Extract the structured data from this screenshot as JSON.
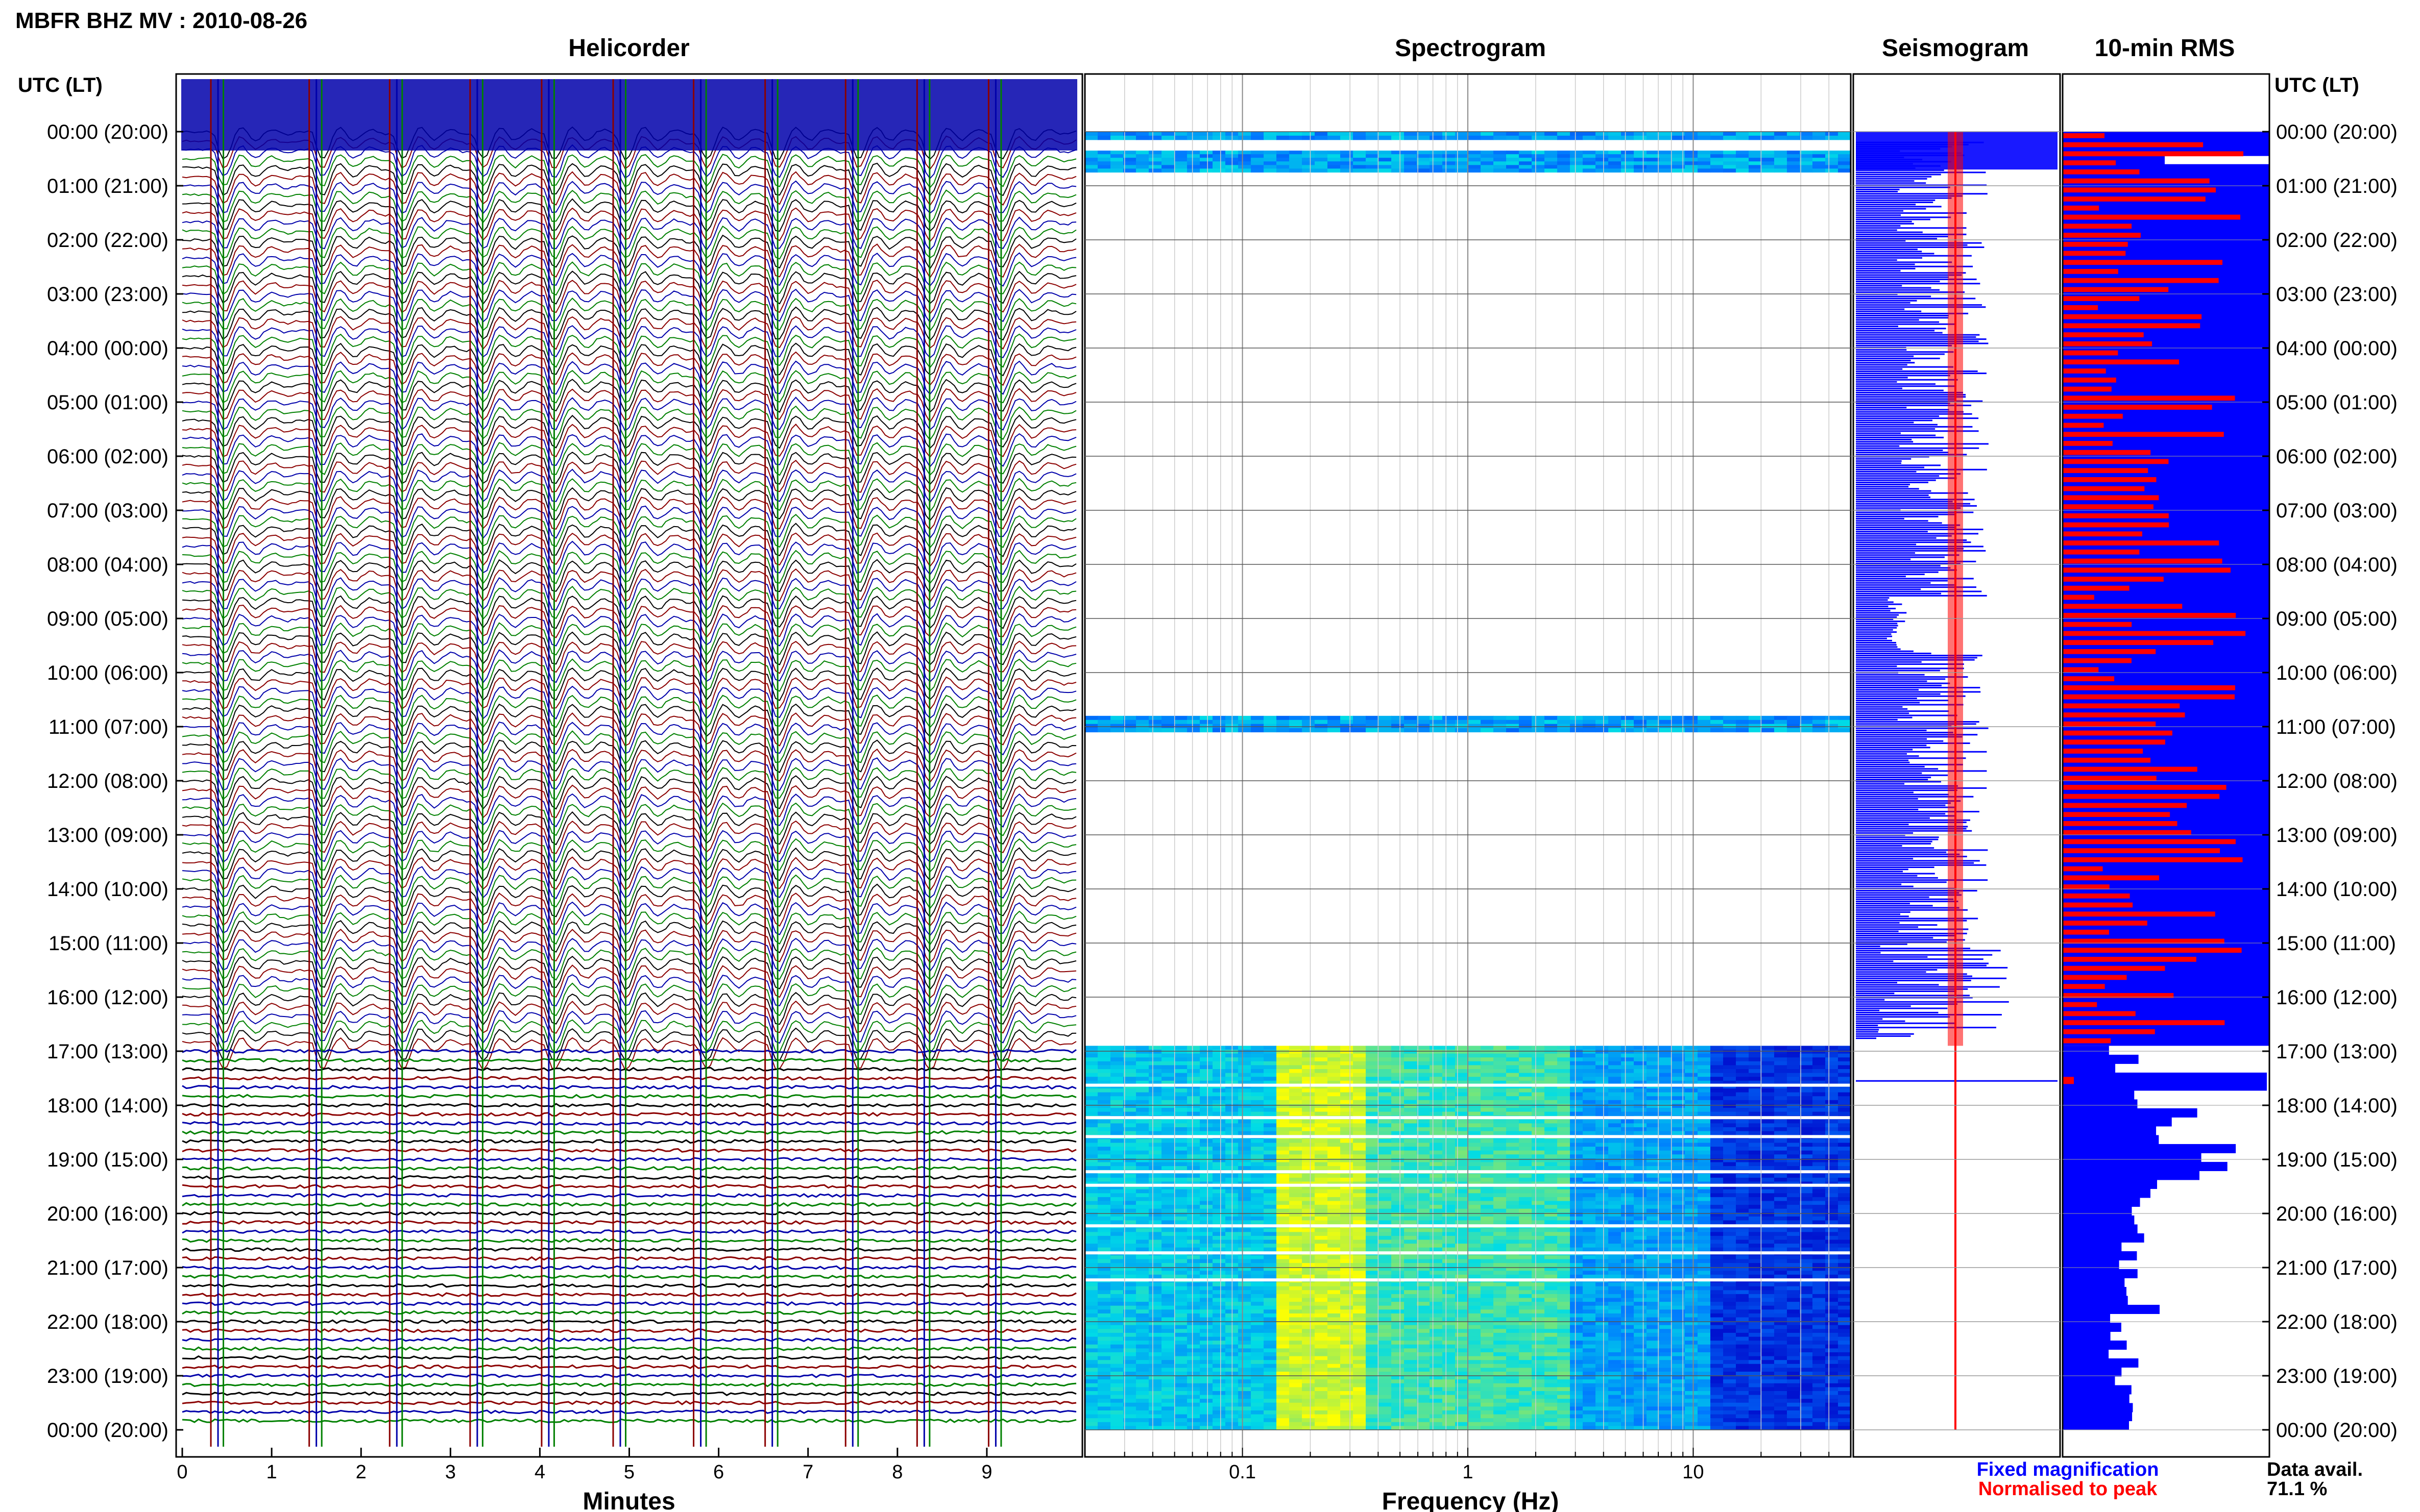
{
  "header": {
    "station_title": "MBFR BHZ MV : 2010-08-26",
    "panel_titles": [
      "Helicorder",
      "Spectrogram",
      "Seismogram",
      "10-min RMS"
    ],
    "utc_header_left": "UTC (LT)",
    "utc_header_right": "UTC (LT)"
  },
  "time_labels": [
    "00:00 (20:00)",
    "01:00 (21:00)",
    "02:00 (22:00)",
    "03:00 (23:00)",
    "04:00 (00:00)",
    "05:00 (01:00)",
    "06:00 (02:00)",
    "07:00 (03:00)",
    "08:00 (04:00)",
    "09:00 (05:00)",
    "10:00 (06:00)",
    "11:00 (07:00)",
    "12:00 (08:00)",
    "13:00 (09:00)",
    "14:00 (10:00)",
    "15:00 (11:00)",
    "16:00 (12:00)",
    "17:00 (13:00)",
    "18:00 (14:00)",
    "19:00 (15:00)",
    "20:00 (16:00)",
    "21:00 (17:00)",
    "22:00 (18:00)",
    "23:00 (19:00)",
    "00:00 (20:00)"
  ],
  "footer": {
    "helicorder_xlabel": "Minutes",
    "spectrogram_xlabel": "Frequency (Hz)",
    "legend_fixed": "Fixed magnification",
    "legend_normalised": "Normalised to peak",
    "data_avail_label": "Data avail.",
    "data_avail_value": "71.1 %"
  },
  "colors": {
    "trace_colors": [
      "#000000",
      "#8b0000",
      "#0000aa",
      "#008000"
    ],
    "fixed_magnification": "#0000ff",
    "normalised_to_peak": "#ff0000",
    "spectrogram_low": "#0000c8",
    "spectrogram_high": "#ffff00"
  },
  "chart_data": [
    {
      "type": "line",
      "title": "Helicorder",
      "xlabel": "Minutes",
      "xlim": [
        0,
        10
      ],
      "x_ticks": [
        "0",
        "1",
        "2",
        "3",
        "4",
        "5",
        "6",
        "7",
        "8",
        "9"
      ],
      "rows_per_hour": 6,
      "hours": 24,
      "quiet_from_hour": 16.9,
      "events_minute": [
        0.4,
        1.5,
        2.4,
        3.3,
        4.1,
        4.9,
        5.8,
        6.6,
        7.5,
        8.3,
        9.1
      ]
    },
    {
      "type": "heatmap",
      "title": "Spectrogram",
      "xlabel": "Frequency (Hz)",
      "xscale": "log",
      "xlim": [
        0.02,
        50
      ],
      "x_ticks": [
        "0.1",
        "1",
        "10"
      ],
      "data_coverage_hours": [
        [
          0.0,
          0.15
        ],
        [
          0.35,
          0.75
        ],
        [
          10.8,
          11.1
        ],
        [
          16.9,
          24.0
        ]
      ]
    },
    {
      "type": "line",
      "title": "Seismogram",
      "series": [
        {
          "name": "Fixed magnification",
          "color": "#0000ff"
        },
        {
          "name": "Normalised to peak",
          "color": "#ff0000"
        }
      ],
      "hours": 24
    },
    {
      "type": "bar",
      "title": "10-min RMS",
      "series": [
        {
          "name": "Fixed magnification",
          "color": "#0000ff"
        },
        {
          "name": "Normalised to peak",
          "color": "#ff0000"
        }
      ],
      "quiet_from_hour": 16.9
    }
  ]
}
